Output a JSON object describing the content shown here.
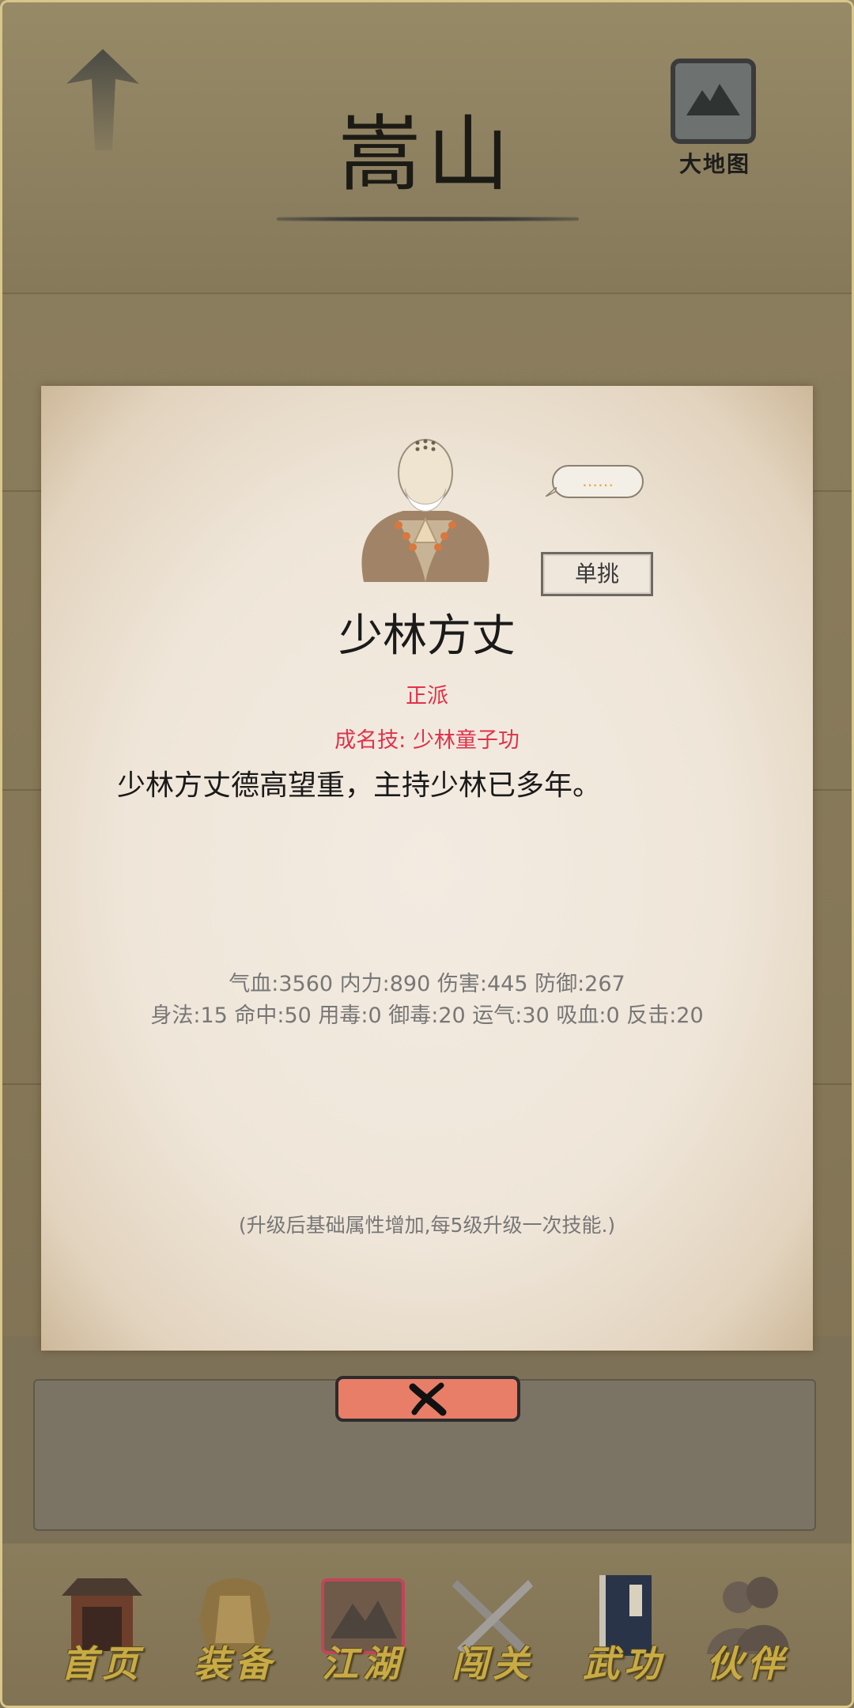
{
  "header": {
    "title": "嵩山",
    "map_label": "大地图"
  },
  "npc": {
    "speech": "……",
    "duel_label": "单挑",
    "name": "少林方丈",
    "faction": "正派",
    "signature_skill": "成名技: 少林童子功",
    "description": "少林方丈德高望重，主持少林已多年。",
    "stats_line1": "气血:3560  内力:890  伤害:445  防御:267",
    "stats_line2": "身法:15  命中:50  用毒:0  御毒:20  运气:30  吸血:0  反击:20",
    "note": "(升级后基础属性增加,每5级升级一次技能.)"
  },
  "close_icon": "close-x-icon",
  "nav": {
    "items": [
      {
        "label": "首页",
        "icon": "temple-icon"
      },
      {
        "label": "装备",
        "icon": "armor-icon"
      },
      {
        "label": "江湖",
        "icon": "scroll-map-icon",
        "active": true
      },
      {
        "label": "闯关",
        "icon": "crossed-swords-icon"
      },
      {
        "label": "武功",
        "icon": "book-icon"
      },
      {
        "label": "伙伴",
        "icon": "partners-icon"
      }
    ]
  },
  "colors": {
    "accent_red": "#e0324a",
    "close_button": "#e87e68",
    "nav_label_gold": "#c8ab45"
  }
}
